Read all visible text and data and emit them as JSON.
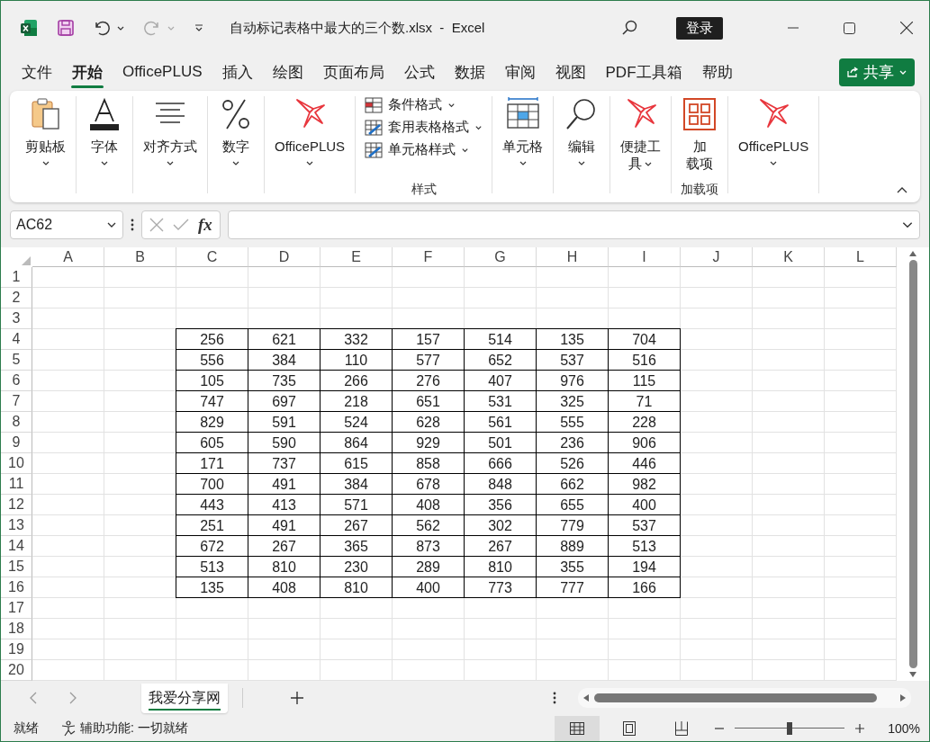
{
  "window": {
    "title": "自动标记表格中最大的三个数.xlsx  -  Excel",
    "sign_in": "登录"
  },
  "menu": {
    "tabs": [
      {
        "label": "文件",
        "selected": false
      },
      {
        "label": "开始",
        "selected": true
      },
      {
        "label": "OfficePLUS",
        "selected": false
      },
      {
        "label": "插入",
        "selected": false
      },
      {
        "label": "绘图",
        "selected": false
      },
      {
        "label": "页面布局",
        "selected": false
      },
      {
        "label": "公式",
        "selected": false
      },
      {
        "label": "数据",
        "selected": false
      },
      {
        "label": "审阅",
        "selected": false
      },
      {
        "label": "视图",
        "selected": false
      },
      {
        "label": "PDF工具箱",
        "selected": false
      },
      {
        "label": "帮助",
        "selected": false
      }
    ],
    "share": "共享"
  },
  "ribbon": {
    "groups": [
      {
        "kind": "large",
        "lines": [
          "剪贴板"
        ],
        "dropdown": true
      },
      {
        "kind": "large",
        "lines": [
          "字体"
        ],
        "dropdown": true
      },
      {
        "kind": "large",
        "lines": [
          "对齐方式"
        ],
        "dropdown": true
      },
      {
        "kind": "large",
        "lines": [
          "数字"
        ],
        "dropdown": true
      },
      {
        "kind": "large",
        "lines": [
          "OfficePLUS"
        ],
        "dropdown": true
      },
      {
        "kind": "list",
        "label": "样式",
        "items": [
          "条件格式",
          "套用表格格式",
          "单元格样式"
        ]
      },
      {
        "kind": "large",
        "lines": [
          "单元格"
        ],
        "dropdown": true
      },
      {
        "kind": "large",
        "lines": [
          "编辑"
        ],
        "dropdown": true
      },
      {
        "kind": "large",
        "lines": [
          "便捷工",
          "具"
        ],
        "dropdown": true
      },
      {
        "kind": "large",
        "lines": [
          "加",
          "载项"
        ],
        "dropdown": false,
        "label": "加载项"
      },
      {
        "kind": "large",
        "lines": [
          "OfficePLUS"
        ],
        "dropdown": true
      }
    ]
  },
  "formula_bar": {
    "name_box": "AC62",
    "fx": "fx"
  },
  "sheet": {
    "columns": [
      "A",
      "B",
      "C",
      "D",
      "E",
      "F",
      "G",
      "H",
      "I",
      "J",
      "K",
      "L"
    ],
    "rows": [
      {
        "number": "1"
      },
      {
        "number": "2"
      },
      {
        "number": "3"
      },
      {
        "number": "4",
        "values": [
          "256",
          "621",
          "332",
          "157",
          "514",
          "135",
          "704"
        ]
      },
      {
        "number": "5",
        "values": [
          "556",
          "384",
          "110",
          "577",
          "652",
          "537",
          "516"
        ]
      },
      {
        "number": "6",
        "values": [
          "105",
          "735",
          "266",
          "276",
          "407",
          "976",
          "115"
        ]
      },
      {
        "number": "7",
        "values": [
          "747",
          "697",
          "218",
          "651",
          "531",
          "325",
          "71"
        ]
      },
      {
        "number": "8",
        "values": [
          "829",
          "591",
          "524",
          "628",
          "561",
          "555",
          "228"
        ]
      },
      {
        "number": "9",
        "values": [
          "605",
          "590",
          "864",
          "929",
          "501",
          "236",
          "906"
        ]
      },
      {
        "number": "10",
        "values": [
          "171",
          "737",
          "615",
          "858",
          "666",
          "526",
          "446"
        ]
      },
      {
        "number": "11",
        "values": [
          "700",
          "491",
          "384",
          "678",
          "848",
          "662",
          "982"
        ]
      },
      {
        "number": "12",
        "values": [
          "443",
          "413",
          "571",
          "408",
          "356",
          "655",
          "400"
        ]
      },
      {
        "number": "13",
        "values": [
          "251",
          "491",
          "267",
          "562",
          "302",
          "779",
          "537"
        ]
      },
      {
        "number": "14",
        "values": [
          "672",
          "267",
          "365",
          "873",
          "267",
          "889",
          "513"
        ]
      },
      {
        "number": "15",
        "values": [
          "513",
          "810",
          "230",
          "289",
          "810",
          "355",
          "194"
        ]
      },
      {
        "number": "16",
        "values": [
          "135",
          "408",
          "810",
          "400",
          "773",
          "777",
          "166"
        ]
      },
      {
        "number": "17"
      },
      {
        "number": "18"
      },
      {
        "number": "19"
      },
      {
        "number": "20"
      }
    ]
  },
  "sheet_tabs": [
    {
      "label": "我爱分享网",
      "selected": true
    }
  ],
  "status_bar": {
    "ready": "就绪",
    "accessibility": "辅助功能: 一切就绪",
    "views": [
      {
        "selected": true
      },
      {
        "selected": false
      },
      {
        "selected": false
      }
    ],
    "zoom": {
      "level": 0.5,
      "reading": "100%"
    }
  }
}
